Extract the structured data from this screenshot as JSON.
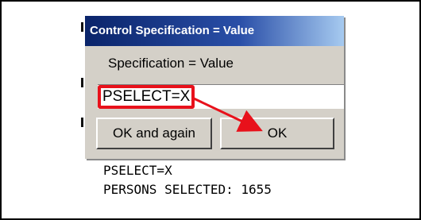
{
  "dialog": {
    "title": "Control Specification = Value",
    "prompt": "Specification = Value",
    "input_value": "PSELECT=X",
    "buttons": {
      "again_label": "OK and again",
      "ok_label": "OK"
    }
  },
  "console": {
    "line1": "PSELECT=X",
    "line2": "PERSONS SELECTED: 1655"
  },
  "colors": {
    "highlight": "#e8111b",
    "titlebar": "#0a246a",
    "dialog_bg": "#d4d0c8"
  }
}
